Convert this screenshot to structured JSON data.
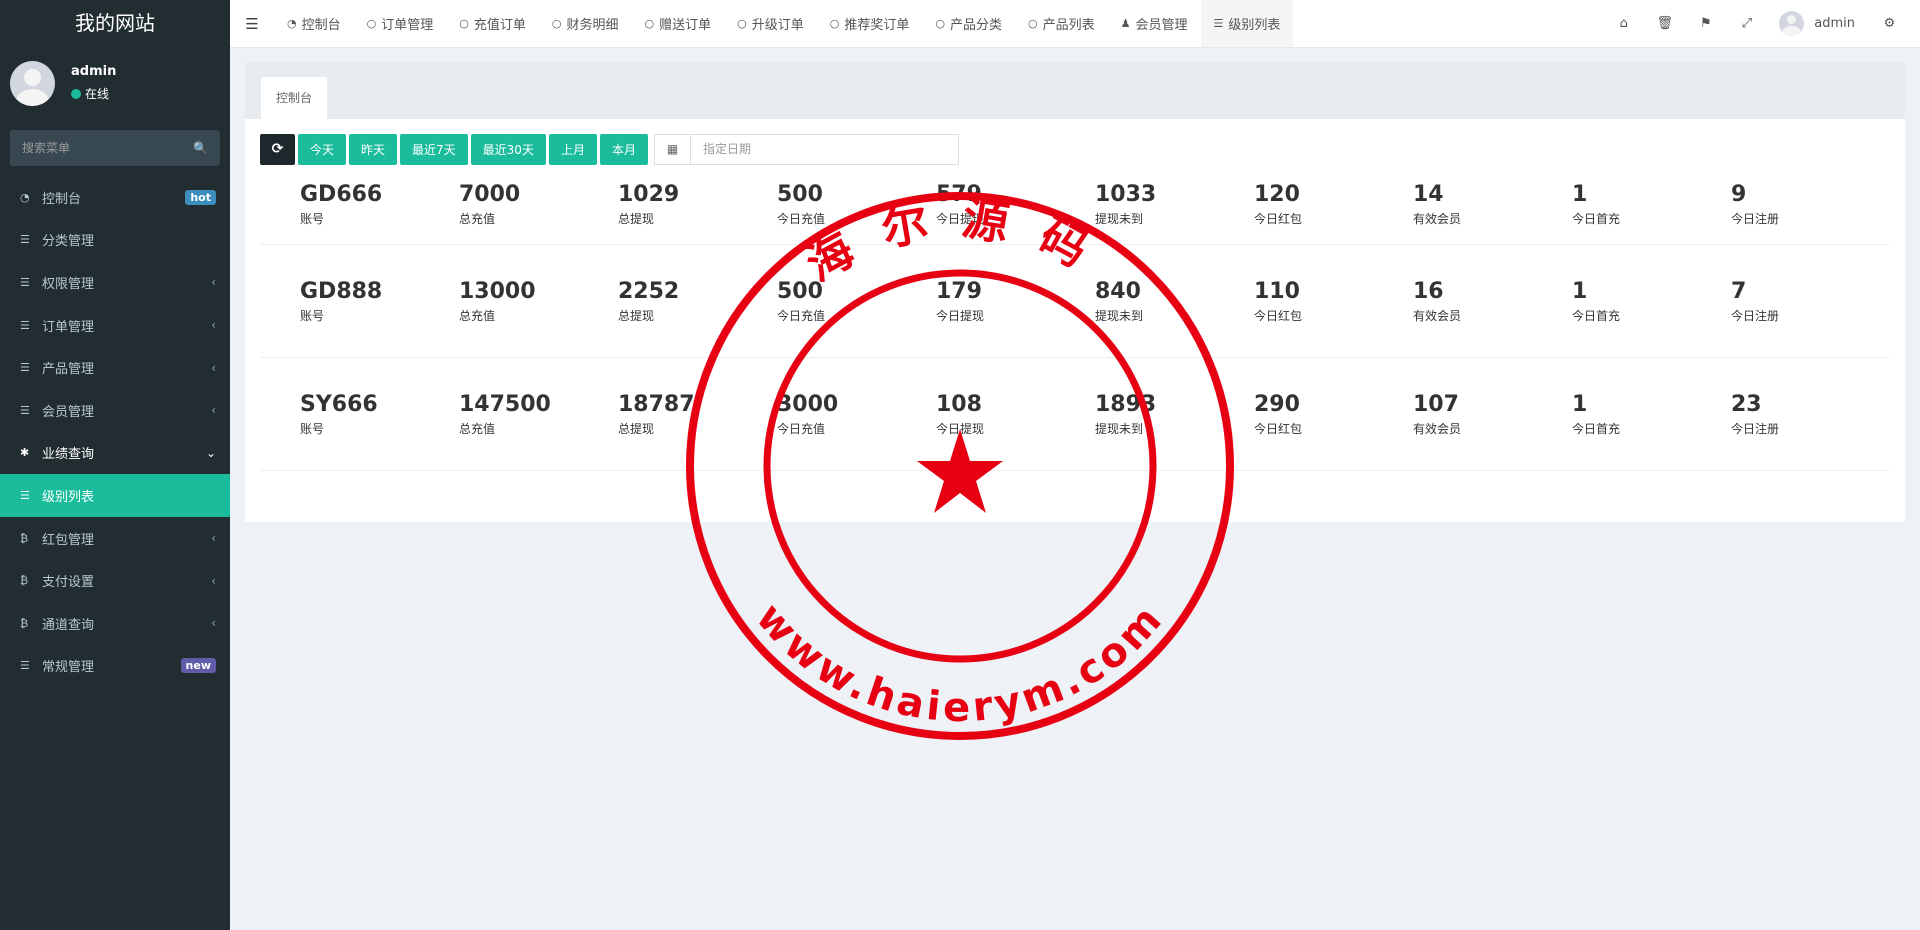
{
  "sidebar": {
    "brand": "我的网站",
    "user": {
      "name": "admin",
      "status": "在线"
    },
    "search_placeholder": "搜索菜单",
    "items": [
      {
        "label": "控制台",
        "badge": "hot"
      },
      {
        "label": "分类管理"
      },
      {
        "label": "权限管理"
      },
      {
        "label": "订单管理"
      },
      {
        "label": "产品管理"
      },
      {
        "label": "会员管理"
      },
      {
        "label": "业绩查询"
      },
      {
        "label": "级别列表"
      },
      {
        "label": "红包管理"
      },
      {
        "label": "支付设置"
      },
      {
        "label": "通道查询"
      },
      {
        "label": "常规管理",
        "badge": "new"
      }
    ]
  },
  "topnav": {
    "tabs": [
      {
        "label": "控制台"
      },
      {
        "label": "订单管理"
      },
      {
        "label": "充值订单"
      },
      {
        "label": "财务明细"
      },
      {
        "label": "赠送订单"
      },
      {
        "label": "升级订单"
      },
      {
        "label": "推荐奖订单"
      },
      {
        "label": "产品分类"
      },
      {
        "label": "产品列表"
      },
      {
        "label": "会员管理"
      },
      {
        "label": "级别列表"
      }
    ],
    "user": "admin"
  },
  "panel": {
    "tab": "控制台",
    "filters": [
      "今天",
      "昨天",
      "最近7天",
      "最近30天",
      "上月",
      "本月"
    ],
    "date_placeholder": "指定日期"
  },
  "stats": [
    {
      "cells": [
        {
          "value": "GD666",
          "label": "账号"
        },
        {
          "value": "7000",
          "label": "总充值"
        },
        {
          "value": "1029",
          "label": "总提现"
        },
        {
          "value": "500",
          "label": "今日充值"
        },
        {
          "value": "579",
          "label": "今日提现"
        },
        {
          "value": "1033",
          "label": "提现未到"
        },
        {
          "value": "120",
          "label": "今日红包"
        },
        {
          "value": "14",
          "label": "有效会员"
        },
        {
          "value": "1",
          "label": "今日首充"
        },
        {
          "value": "9",
          "label": "今日注册"
        }
      ]
    },
    {
      "cells": [
        {
          "value": "GD888",
          "label": "账号"
        },
        {
          "value": "13000",
          "label": "总充值"
        },
        {
          "value": "2252",
          "label": "总提现"
        },
        {
          "value": "500",
          "label": "今日充值"
        },
        {
          "value": "179",
          "label": "今日提现"
        },
        {
          "value": "840",
          "label": "提现未到"
        },
        {
          "value": "110",
          "label": "今日红包"
        },
        {
          "value": "16",
          "label": "有效会员"
        },
        {
          "value": "1",
          "label": "今日首充"
        },
        {
          "value": "7",
          "label": "今日注册"
        }
      ]
    },
    {
      "cells": [
        {
          "value": "SY666",
          "label": "账号"
        },
        {
          "value": "147500",
          "label": "总充值"
        },
        {
          "value": "18787",
          "label": "总提现"
        },
        {
          "value": "3000",
          "label": "今日充值"
        },
        {
          "value": "108",
          "label": "今日提现"
        },
        {
          "value": "1893",
          "label": "提现未到"
        },
        {
          "value": "290",
          "label": "今日红包"
        },
        {
          "value": "107",
          "label": "有效会员"
        },
        {
          "value": "1",
          "label": "今日首充"
        },
        {
          "value": "23",
          "label": "今日注册"
        }
      ]
    }
  ],
  "watermark": {
    "top_text": "海尔源码",
    "bottom_text": "www.haierym.com",
    "color": "#e60012"
  },
  "colors": {
    "accent": "#1abc9c",
    "sidebar_bg": "#222d32",
    "hot": "#3c8dbc",
    "new": "#605ca8"
  }
}
